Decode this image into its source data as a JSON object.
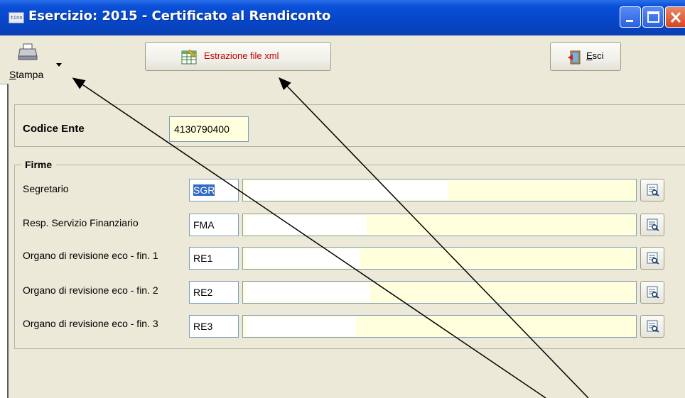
{
  "window": {
    "title": "Esercizio: 2015 - Certificato al Rendiconto",
    "app_icon_text": "tinn"
  },
  "toolbar": {
    "print_label": "Stampa",
    "print_mnemonic": "S",
    "print_label_rest": "tampa",
    "xml_label": "Estrazione file xml",
    "exit_label": "Esci",
    "exit_mnemonic": "E",
    "exit_label_rest": "sci"
  },
  "codice_ente": {
    "label": "Codice Ente",
    "value": "4130790400"
  },
  "firme": {
    "legend": "Firme",
    "rows": [
      {
        "label": "Segretario",
        "code": "SGR",
        "code_selected": true
      },
      {
        "label": "Resp. Servizio Finanziario",
        "code": "FMA",
        "code_selected": false
      },
      {
        "label": "Organo di revisione eco - fin. 1",
        "code": "RE1",
        "code_selected": false
      },
      {
        "label": "Organo di revisione eco - fin. 2",
        "code": "RE2",
        "code_selected": false
      },
      {
        "label": "Organo di revisione eco - fin. 3",
        "code": "RE3",
        "code_selected": false
      }
    ]
  },
  "colors": {
    "titlebar": "#0a4fd8",
    "panel_bg": "#ece9d8",
    "input_yellow": "#ffffdd",
    "selection": "#316ac5",
    "xml_text": "#c00000"
  },
  "icons": {
    "print": "printer-icon",
    "xml": "spreadsheet-icon",
    "exit": "exit-door-icon",
    "lookup": "lookup-search-icon"
  }
}
